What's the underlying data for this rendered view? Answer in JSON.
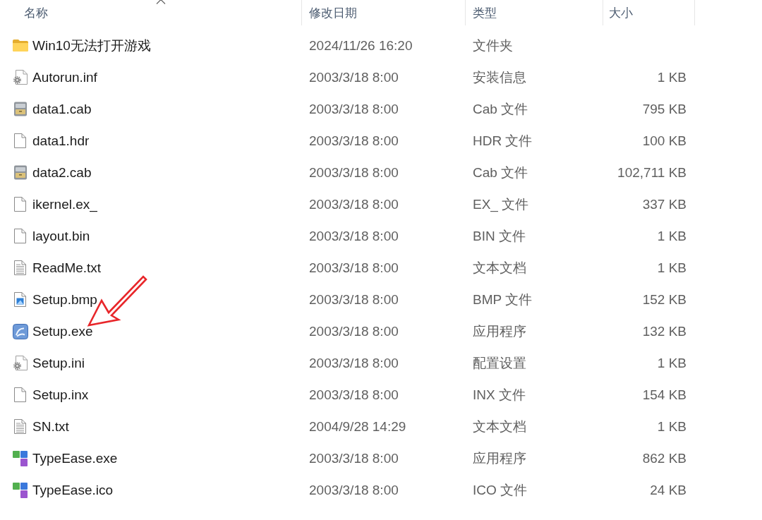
{
  "columns": [
    {
      "label": "名称",
      "sorted": true
    },
    {
      "label": "修改日期",
      "sorted": false
    },
    {
      "label": "类型",
      "sorted": false
    },
    {
      "label": "大小",
      "sorted": false
    }
  ],
  "files": [
    {
      "kind": "folder",
      "name": "Win10无法打开游戏",
      "modified": "2024/11/26 16:20",
      "type": "文件夹",
      "annotated": false
    },
    {
      "kind": "config",
      "name": "Autorun.inf",
      "modified": "2003/3/18 8:00",
      "type": "安装信息",
      "size": "1 KB",
      "annotated": false
    },
    {
      "kind": "cabinet",
      "name": "data1.cab",
      "modified": "2003/3/18 8:00",
      "type": "Cab 文件",
      "size": "795 KB",
      "annotated": false
    },
    {
      "kind": "file",
      "name": "data1.hdr",
      "modified": "2003/3/18 8:00",
      "type": "HDR 文件",
      "size": "100 KB",
      "annotated": false
    },
    {
      "kind": "cabinet",
      "name": "data2.cab",
      "modified": "2003/3/18 8:00",
      "type": "Cab 文件",
      "size": "102,711 KB",
      "annotated": false
    },
    {
      "kind": "file",
      "name": "ikernel.ex_",
      "modified": "2003/3/18 8:00",
      "type": "EX_ 文件",
      "size": "337 KB",
      "annotated": false
    },
    {
      "kind": "file",
      "name": "layout.bin",
      "modified": "2003/3/18 8:00",
      "type": "BIN 文件",
      "size": "1 KB",
      "annotated": false
    },
    {
      "kind": "text",
      "name": "ReadMe.txt",
      "modified": "2003/3/18 8:00",
      "type": "文本文档",
      "size": "1 KB",
      "annotated": false
    },
    {
      "kind": "image",
      "name": "Setup.bmp",
      "modified": "2003/3/18 8:00",
      "type": "BMP 文件",
      "size": "152 KB",
      "annotated": false
    },
    {
      "kind": "installer",
      "name": "Setup.exe",
      "modified": "2003/3/18 8:00",
      "type": "应用程序",
      "size": "132 KB",
      "annotated": true
    },
    {
      "kind": "config",
      "name": "Setup.ini",
      "modified": "2003/3/18 8:00",
      "type": "配置设置",
      "size": "1 KB",
      "annotated": false
    },
    {
      "kind": "file",
      "name": "Setup.inx",
      "modified": "2003/3/18 8:00",
      "type": "INX 文件",
      "size": "154 KB",
      "annotated": false
    },
    {
      "kind": "text",
      "name": "SN.txt",
      "modified": "2004/9/28 14:29",
      "type": "文本文档",
      "size": "1 KB",
      "annotated": false
    },
    {
      "kind": "tiles",
      "name": "TypeEase.exe",
      "modified": "2003/3/18 8:00",
      "type": "应用程序",
      "size": "862 KB",
      "annotated": false
    },
    {
      "kind": "tiles",
      "name": "TypeEase.ico",
      "modified": "2003/3/18 8:00",
      "type": "ICO 文件",
      "size": "24 KB",
      "annotated": false
    }
  ]
}
